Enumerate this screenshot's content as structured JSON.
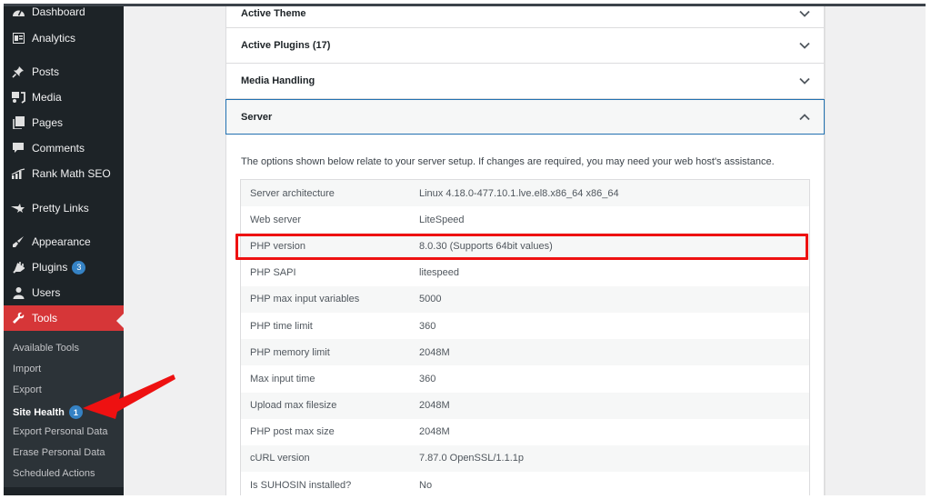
{
  "sidebar": {
    "items": [
      {
        "label": "Dashboard",
        "icon": "dashboard-icon"
      },
      {
        "label": "Analytics",
        "icon": "analytics-icon"
      },
      {
        "label": "Posts",
        "icon": "pushpin-icon"
      },
      {
        "label": "Media",
        "icon": "media-icon"
      },
      {
        "label": "Pages",
        "icon": "pages-icon"
      },
      {
        "label": "Comments",
        "icon": "comment-icon"
      },
      {
        "label": "Rank Math SEO",
        "icon": "rank-math-icon"
      },
      {
        "label": "Pretty Links",
        "icon": "pretty-links-icon"
      },
      {
        "label": "Appearance",
        "icon": "paintbrush-icon"
      },
      {
        "label": "Plugins",
        "icon": "plugin-icon",
        "badge": "3"
      },
      {
        "label": "Users",
        "icon": "user-icon"
      },
      {
        "label": "Tools",
        "icon": "wrench-icon",
        "active": true
      }
    ],
    "submenu": [
      {
        "label": "Available Tools"
      },
      {
        "label": "Import"
      },
      {
        "label": "Export"
      },
      {
        "label": "Site Health",
        "badge": "1",
        "current": true
      },
      {
        "label": "Export Personal Data"
      },
      {
        "label": "Erase Personal Data"
      },
      {
        "label": "Scheduled Actions"
      }
    ]
  },
  "main": {
    "accordions": [
      {
        "title": "Active Theme",
        "expanded": false
      },
      {
        "title": "Active Plugins (17)",
        "expanded": false
      },
      {
        "title": "Media Handling",
        "expanded": false
      },
      {
        "title": "Server",
        "expanded": true
      }
    ],
    "server": {
      "description": "The options shown below relate to your server setup. If changes are required, you may need your web host's assistance.",
      "rows": [
        {
          "key": "Server architecture",
          "value": "Linux 4.18.0-477.10.1.lve.el8.x86_64 x86_64"
        },
        {
          "key": "Web server",
          "value": "LiteSpeed"
        },
        {
          "key": "PHP version",
          "value": "8.0.30 (Supports 64bit values)",
          "highlighted": true
        },
        {
          "key": "PHP SAPI",
          "value": "litespeed"
        },
        {
          "key": "PHP max input variables",
          "value": "5000"
        },
        {
          "key": "PHP time limit",
          "value": "360"
        },
        {
          "key": "PHP memory limit",
          "value": "2048M"
        },
        {
          "key": "Max input time",
          "value": "360"
        },
        {
          "key": "Upload max filesize",
          "value": "2048M"
        },
        {
          "key": "PHP post max size",
          "value": "2048M"
        },
        {
          "key": "cURL version",
          "value": "7.87.0 OpenSSL/1.1.1p"
        },
        {
          "key": "Is SUHOSIN installed?",
          "value": "No"
        }
      ]
    }
  },
  "colors": {
    "sidebar_bg": "#1d2327",
    "submenu_bg": "#2c3338",
    "active_menu": "#d63638",
    "badge": "#3582c4",
    "accordion_open_border": "#2271b1",
    "highlight_box": "#ee1111",
    "annotation_arrow": "#ee1111"
  }
}
